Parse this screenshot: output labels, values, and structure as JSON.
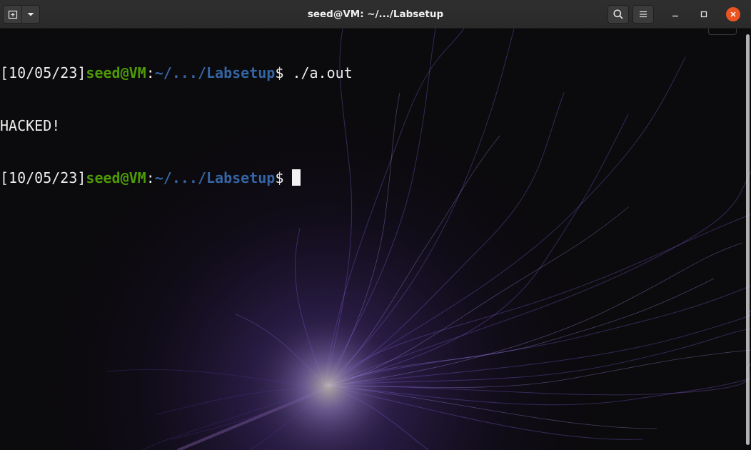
{
  "window": {
    "title": "seed@VM: ~/.../Labsetup"
  },
  "titlebar": {
    "new_tab_icon": "new-tab-icon",
    "dropdown_icon": "chevron-down-icon",
    "search_icon": "search-icon",
    "menu_icon": "hamburger-menu-icon",
    "minimize_icon": "minimize-icon",
    "maximize_icon": "maximize-icon",
    "close_icon": "close-icon"
  },
  "terminal": {
    "lines": [
      {
        "timestamp": "[10/05/23]",
        "user": "seed@VM",
        "sep": ":",
        "path": "~/.../Labsetup",
        "prompt": "$ ",
        "command": "./a.out"
      },
      {
        "output": "HACKED!"
      },
      {
        "timestamp": "[10/05/23]",
        "user": "seed@VM",
        "sep": ":",
        "path": "~/.../Labsetup",
        "prompt": "$ ",
        "command": ""
      }
    ]
  },
  "colors": {
    "titlebar": "#2c2c2c",
    "close_button": "#e95420",
    "user_green": "#4e9a06",
    "path_blue": "#3465a4",
    "text": "#ececec",
    "background": "#0b0a0c",
    "plasma_purple": "#7b4fd6"
  }
}
